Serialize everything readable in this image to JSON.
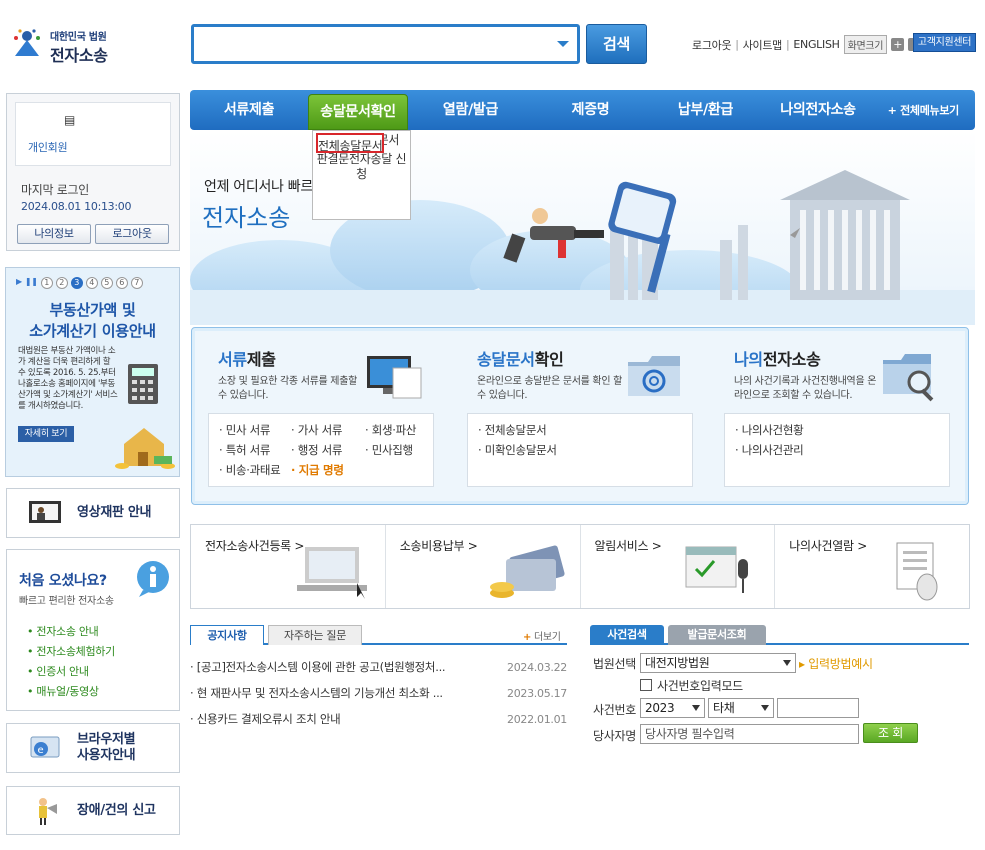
{
  "logo": {
    "line1": "대한민국 법원",
    "line2": "전자소송"
  },
  "search": {
    "button": "검색",
    "value": ""
  },
  "util": {
    "logout": "로그아웃",
    "sitemap": "사이트맵",
    "english": "ENGLISH",
    "fontsize": "화면크기",
    "plus": "+",
    "minus": "-",
    "support": "고객지원센터"
  },
  "nav": {
    "items": [
      "서류제출",
      "송달문서확인",
      "열람/발급",
      "제증명",
      "납부/환급",
      "나의전자소송"
    ],
    "all_menu": "+ 전체메뉴보기",
    "submenu": [
      "전체송달문서",
      "미확인송달문서",
      "판결문전자송달 신청"
    ]
  },
  "login": {
    "member_type": "개인회원",
    "last_login_label": "마지막 로그인",
    "last_login_time": "2024.08.01 10:13:00",
    "myinfo": "나의정보",
    "logout": "로그아웃"
  },
  "banner": {
    "pages": [
      "1",
      "2",
      "3",
      "4",
      "5",
      "6",
      "7"
    ],
    "current_page": 3,
    "title_line1": "부동산가액 및",
    "title_line2": "소가계산기 이용안내",
    "desc": "대법원은 부동산 가액이나 소가 계산을 더욱 편리하게 할 수 있도록 2016. 5. 25.부터 나홀로소송 홈페이지에 '부동산가액 및 소가계산기' 서비스를 개시하였습니다.",
    "more": "자세히 보기"
  },
  "video": {
    "label": "영상재판 안내"
  },
  "first": {
    "title": "처음 오셨나요?",
    "subtitle": "빠르고 편리한 전자소송",
    "links": [
      "• 전자소송 안내",
      "• 전자소송체험하기",
      "• 인증서 안내",
      "• 매뉴얼/동영상"
    ]
  },
  "browser": {
    "line1": "브라우저별",
    "line2": "사용자안내"
  },
  "report": {
    "label": "장애/건의 신고"
  },
  "hero": {
    "tagline": "언제 어디서나 빠르",
    "title": "전자소송"
  },
  "services": [
    {
      "title_a": "서류",
      "title_b": "제출",
      "desc": "소장 및 필요한 각종 서류를 제출할 수 있습니다.",
      "links": [
        "· 민사 서류",
        "· 가사 서류",
        "· 회생·파산",
        "· 특허 서류",
        "· 행정 서류",
        "· 민사집행",
        "· 비송·과태료",
        "· 지급 명령"
      ]
    },
    {
      "title_a": "송달문서",
      "title_b": "확인",
      "desc": "온라인으로 송달받은 문서를 확인 할 수 있습니다.",
      "links": [
        "· 전체송달문서",
        "· 미확인송달문서"
      ]
    },
    {
      "title_a": "나의",
      "title_b": "전자소송",
      "desc": "나의 사건기록과 사건진행내역을 온라인으로 조회할 수 있습니다.",
      "links": [
        "· 나의사건현황",
        "· 나의사건관리"
      ]
    }
  ],
  "quick": [
    "전자소송사건등록 >",
    "소송비용납부 >",
    "알림서비스 >",
    "나의사건열람 >"
  ],
  "notice": {
    "tabs": [
      "공지사항",
      "자주하는 질문"
    ],
    "more_plus": "+",
    "more": " 더보기",
    "rows": [
      {
        "title": "· [공고]전자소송시스템 이용에 관한 공고(법원행정처...",
        "date": "2024.03.22"
      },
      {
        "title": "· 현 재판사무 및 전자소송시스템의 기능개선 최소화 ...",
        "date": "2023.05.17"
      },
      {
        "title": "· 신용카드 결제오류시 조치 안내",
        "date": "2022.01.01"
      }
    ]
  },
  "case": {
    "tabs": [
      "사건검색",
      "발급문서조회"
    ],
    "court_label": "법원선택",
    "court_value": "대전지방법원",
    "input_method": "▸ 입력방법예시",
    "mode_label": "사건번호입력모드",
    "caseno_label": "사건번호",
    "year": "2023",
    "kind": "타채",
    "number": "",
    "party_label": "당사자명",
    "party_placeholder": "당사자명 필수입력",
    "lookup": "조 회"
  }
}
